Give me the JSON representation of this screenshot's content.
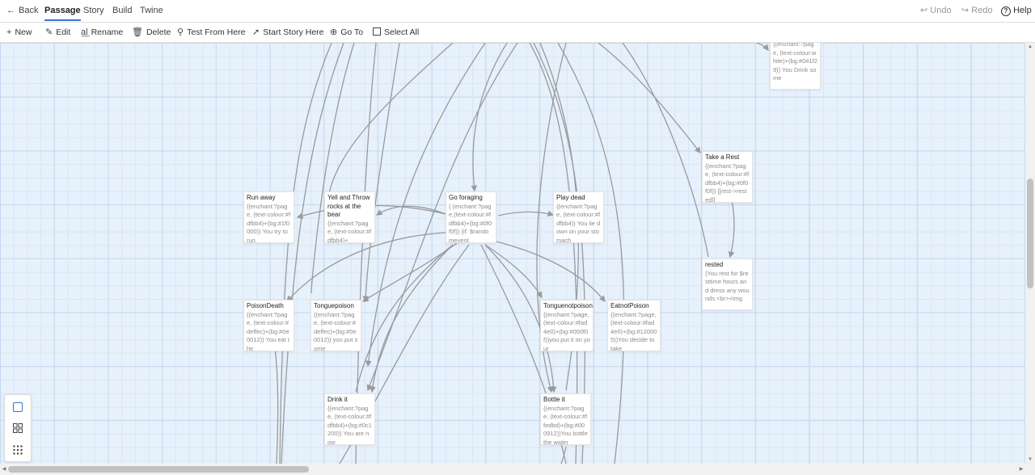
{
  "topbar": {
    "back_label": "Back",
    "tabs": [
      {
        "label": "Passage"
      },
      {
        "label": "Story"
      },
      {
        "label": "Build"
      },
      {
        "label": "Twine"
      }
    ],
    "undo_label": "Undo",
    "redo_label": "Redo",
    "help_label": "Help"
  },
  "toolbar": {
    "new_label": "New",
    "edit_label": "Edit",
    "rename_label": "Rename",
    "delete_label": "Delete",
    "test_label": "Test From Here",
    "start_label": "Start Story Here",
    "goto_label": "Go To",
    "selectall_label": "Select All"
  },
  "passages": [
    {
      "title": "",
      "excerpt": "{(enchant:?page, (text-colour:white)+(bg:#041f29)) You Drink some"
    },
    {
      "title": "Take a Rest",
      "excerpt": "{(enchant:?page, (text-colour:#fdfbb4)+(bg:#0f0f0f)) [[rest->rested]]"
    },
    {
      "title": "Run away",
      "excerpt": "{(enchant:?page, (text-colour:#fdfbb4)+(bg:#1f0000)) You try to run"
    },
    {
      "title": "Yell and Throw rocks at the bear",
      "excerpt": "{(enchant:?page, (text-colour:#fdfbb4)+"
    },
    {
      "title": "Go foraging",
      "excerpt": "{ (enchant:?page,(text-colour:#fdfbb4)+(bg:#0f0f0f)) (if: $randomevent"
    },
    {
      "title": "Play dead",
      "excerpt": "{(enchant:?page, (text-colour:#fdfbb4)) You lie down on your stomach"
    },
    {
      "title": "rested",
      "excerpt": "{You rest for $resttime hours and dress any wounds.<br><img"
    },
    {
      "title": "PoisonDeath",
      "excerpt": "{(enchant:?page, (text-colour:#deffec)+(bg:#0e0012)) You eat the"
    },
    {
      "title": "Tonguepoison",
      "excerpt": "{(enchant:?page, (text-colour:#deffec)+(bg:#0e0012)) you put some"
    },
    {
      "title": "Tonguenotpoison",
      "excerpt": "{(enchant:?page, (text-colour:#fad4e0)+(bg:#000f0f))you put it on your"
    },
    {
      "title": "EatnotPoison",
      "excerpt": "{(enchant:?page, (text-colour:#fad4e0)+(bg:#120005))You decide to take"
    },
    {
      "title": "Drink it",
      "excerpt": "{(enchant:?page, (text-colour:#fdfbb4)+(bg:#0c1200)) You are now"
    },
    {
      "title": "Bottle it",
      "excerpt": "{(enchant:?page, (text-colour:#ffedbd)+(bg:#000912))You bottle the water"
    }
  ],
  "colors": {
    "accent": "#3a74c4",
    "canvas_bg": "#e7f1fc",
    "link_stroke": "#9a9a9a"
  }
}
